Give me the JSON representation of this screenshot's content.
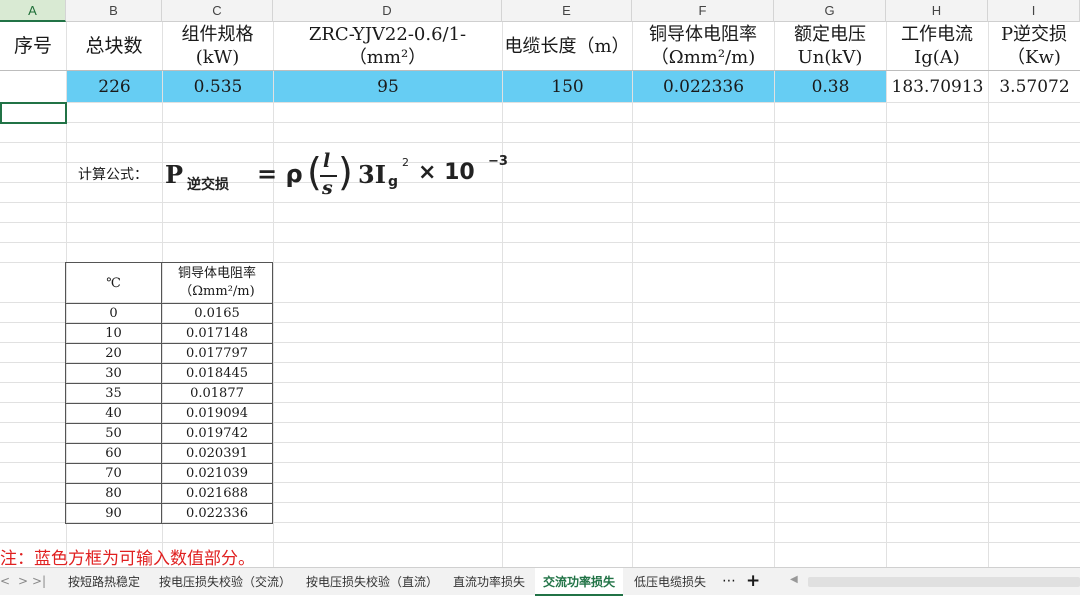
{
  "columns": [
    "A",
    "B",
    "C",
    "D",
    "E",
    "F",
    "G",
    "H",
    "I"
  ],
  "header": {
    "seq": "序号",
    "count": "总块数",
    "spec": [
      "组件规格",
      "(kW)"
    ],
    "cable": [
      "ZRC-YJV22-0.6/1-",
      "（mm²）"
    ],
    "length": "电缆长度（m）",
    "resist": [
      "铜导体电阻率",
      "（Ωmm²/m)"
    ],
    "voltage": [
      "额定电压",
      "Un(kV)"
    ],
    "current": [
      "工作电流",
      "Ig(A)"
    ],
    "ploss": [
      "P逆交损",
      "（Kw)"
    ]
  },
  "row": {
    "seq": "",
    "count": "226",
    "spec": "0.535",
    "cable": "95",
    "length": "150",
    "resist": "0.022336",
    "voltage": "0.38",
    "current": "183.70913",
    "ploss": "3.57072"
  },
  "formula": {
    "label": "计算公式：",
    "P": "P",
    "P_sub": "逆交损",
    "eq": "= ρ",
    "l": "l",
    "s": "s",
    "three": "3I",
    "g": "g",
    "sq": "2",
    "times": "× 10",
    "exp": "−3"
  },
  "table": {
    "col1": "℃",
    "col2": [
      "铜导体电阻率",
      "（Ωmm²/m)"
    ],
    "rows": [
      [
        "0",
        "0.0165"
      ],
      [
        "10",
        "0.017148"
      ],
      [
        "20",
        "0.017797"
      ],
      [
        "30",
        "0.018445"
      ],
      [
        "35",
        "0.01877"
      ],
      [
        "40",
        "0.019094"
      ],
      [
        "50",
        "0.019742"
      ],
      [
        "60",
        "0.020391"
      ],
      [
        "70",
        "0.021039"
      ],
      [
        "80",
        "0.021688"
      ],
      [
        "90",
        "0.022336"
      ]
    ]
  },
  "note": "注：蓝色方框为可输入数值部分。",
  "tabs": {
    "items": [
      "按短路热稳定",
      "按电压损失校验（交流）",
      "按电压损失校验（直流）",
      "直流功率损失",
      "交流功率损失",
      "低压电缆损失"
    ],
    "active_index": 4,
    "more": "⋯",
    "add": "+",
    "nav_first": "|<",
    "nav_prev": "<",
    "nav_next": ">",
    "nav_last": ">|"
  },
  "colors": {
    "input_fill": "#66cdf3",
    "note": "#e02020",
    "accent": "#217346"
  }
}
